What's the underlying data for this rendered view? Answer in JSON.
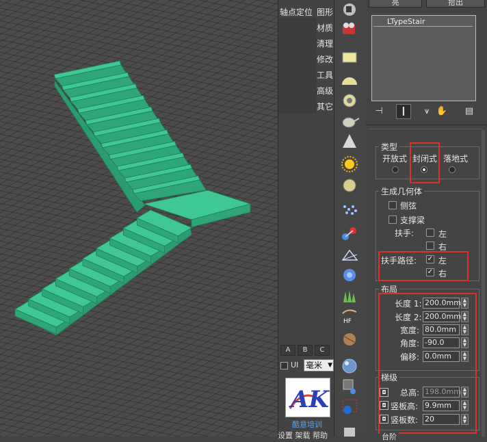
{
  "menu": {
    "items": [
      "轴点定位",
      "图形",
      "材质",
      "清理",
      "修改",
      "工具",
      "高级",
      "其它"
    ],
    "abc": [
      "A",
      "B",
      "C"
    ],
    "ui_label": "UI",
    "units_value": "毫米",
    "logo_text": "AK",
    "logo_caption": "酷意培训",
    "bottom_menu": "设置 架载 帮助"
  },
  "panel": {
    "header_left": "亮",
    "header_right": "拾出",
    "modifier_item": "LTypeStair",
    "type_group": {
      "title": "类型",
      "options": [
        "开放式",
        "封闭式",
        "落地式"
      ],
      "selected": "封闭式"
    },
    "geometry_group": {
      "title": "生成几何体",
      "stringers_label": "侧弦",
      "stringers_checked": false,
      "carriage_label": "支撑梁",
      "carriage_checked": false,
      "handrail_label": "扶手:",
      "handrail_left": "左",
      "handrail_right": "右",
      "handrail_left_checked": false,
      "handrail_right_checked": false,
      "rail_path_label": "扶手路径:",
      "rail_path_left": "左",
      "rail_path_right": "右",
      "rail_path_left_checked": true,
      "rail_path_right_checked": true
    },
    "layout_group": {
      "title": "布局",
      "length1_label": "长度 1:",
      "length1_value": "200.0mm",
      "length2_label": "长度 2:",
      "length2_value": "200.0mm",
      "width_label": "宽度:",
      "width_value": "80.0mm",
      "angle_label": "角度:",
      "angle_value": "-90.0",
      "offset_label": "偏移:",
      "offset_value": "0.0mm"
    },
    "steps_group": {
      "title": "梯级",
      "total_height_label": "总高:",
      "total_height_value": "198.0mm",
      "riser_height_label": "竖板高:",
      "riser_height_value": "9.9mm",
      "riser_count_label": "竖板数:",
      "riser_count_value": "20"
    },
    "next_group_title": "台阶"
  },
  "colors": {
    "stair_top": "#3fc794",
    "stair_front": "#2ea678",
    "highlight": "#e0302a"
  }
}
